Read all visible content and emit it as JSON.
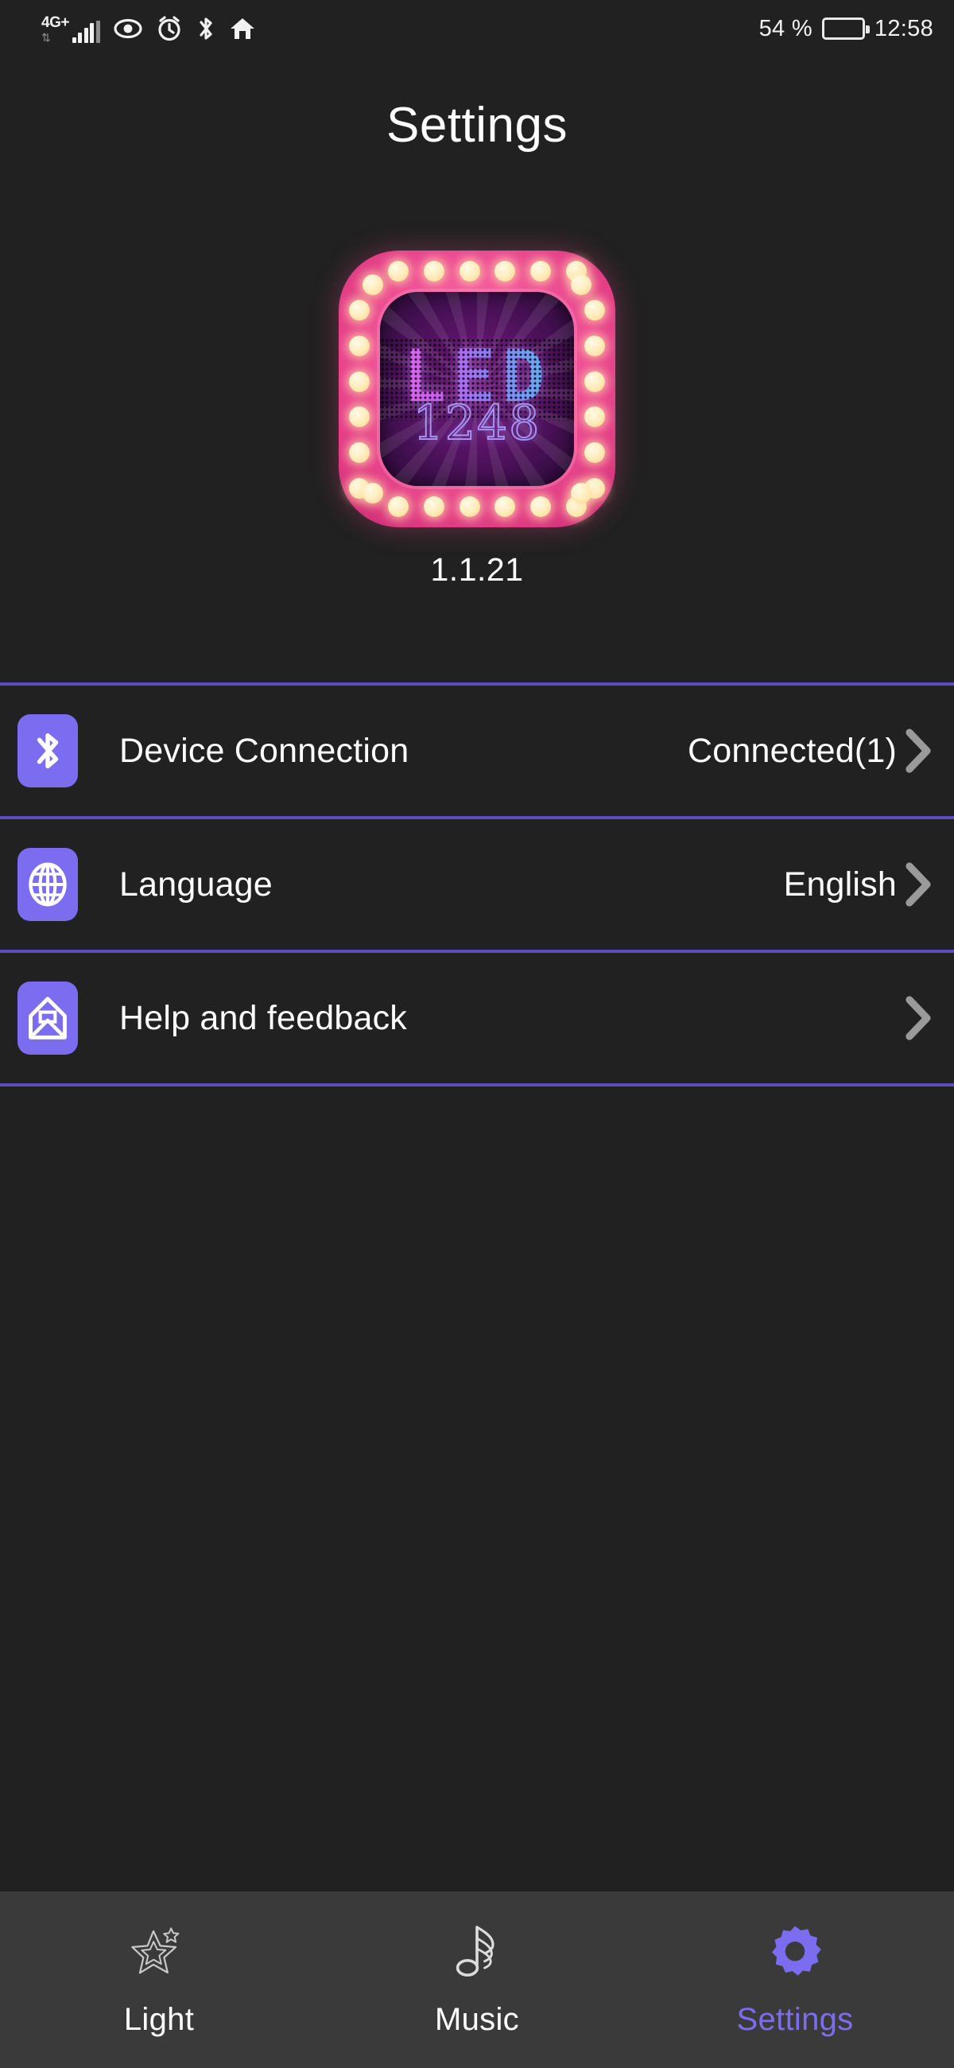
{
  "statusbar": {
    "network_generation": "4G+",
    "data_arrows": "⇅",
    "signal_icon": "signal-bars-icon",
    "eye_icon": "eye-icon",
    "alarm_icon": "alarm-clock-icon",
    "bluetooth_icon": "bluetooth-icon",
    "home_icon": "home-icon",
    "battery_percent": "54 %",
    "battery_level": 54,
    "time": "12:58"
  },
  "header": {
    "title": "Settings"
  },
  "logo": {
    "word": "LED",
    "number": "1248",
    "version": "1.1.21",
    "frame_color": "#ef4f93",
    "bulb_color": "#ffeec0",
    "interior_color": "#5b1468"
  },
  "settings": {
    "rows": [
      {
        "id": "device-connection",
        "icon": "bluetooth-icon",
        "label": "Device Connection",
        "value": "Connected(1)"
      },
      {
        "id": "language",
        "icon": "globe-icon",
        "label": "Language",
        "value": "English"
      },
      {
        "id": "help-and-feedback",
        "icon": "envelope-icon",
        "label": "Help and feedback",
        "value": ""
      }
    ],
    "chevron_icon": "chevron-right-icon",
    "divider_color": "#5b4dbe",
    "icon_tile_color": "#7b6cf0"
  },
  "bottom_nav": {
    "items": [
      {
        "id": "light",
        "label": "Light",
        "icon": "star-outline-icon",
        "active": false
      },
      {
        "id": "music",
        "label": "Music",
        "icon": "music-note-icon",
        "active": false
      },
      {
        "id": "settings",
        "label": "Settings",
        "icon": "gear-icon",
        "active": true
      }
    ],
    "active_color": "#7b6cf0",
    "inactive_color": "#ffffff"
  },
  "colors": {
    "background": "#212121",
    "bottom_bar": "#3a3a3a",
    "accent": "#7b6cf0",
    "divider": "#5b4dbe",
    "chevron": "#9a9a9a"
  }
}
